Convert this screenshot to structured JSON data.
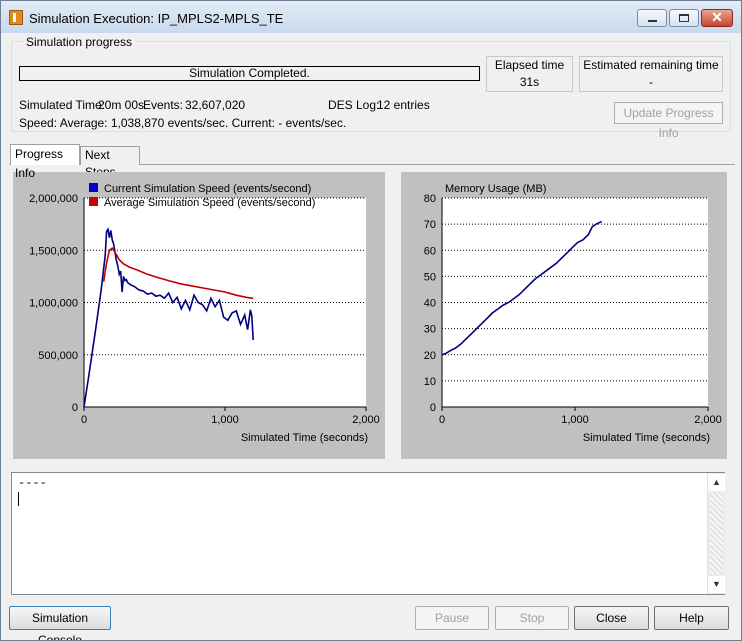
{
  "window": {
    "title": "Simulation Execution: IP_MPLS2-MPLS_TE"
  },
  "progress": {
    "group_label": "Simulation progress",
    "status": "Simulation Completed.",
    "elapsed_label": "Elapsed time",
    "elapsed_value": "31s",
    "remaining_label": "Estimated remaining time",
    "remaining_value": "-",
    "simulated_time_label": "Simulated Time:",
    "simulated_time_value": "20m 00s",
    "events_label": "Events:",
    "events_value": "32,607,020",
    "des_log_label": "DES Log:",
    "des_log_value": "12 entries",
    "speed_line": "Speed: Average: 1,038,870 events/sec. Current: - events/sec.",
    "update_button": "Update Progress Info"
  },
  "tabs": [
    {
      "label": "Progress Info"
    },
    {
      "label": "Next Steps"
    }
  ],
  "chart_data": [
    {
      "type": "line",
      "xlabel": "Simulated Time (seconds)",
      "ylabel": "",
      "xlim": [
        0,
        2000
      ],
      "ylim": [
        0,
        2000000
      ],
      "x_ticks": [
        "0",
        "1,000",
        "2,000"
      ],
      "y_ticks": [
        "0",
        "500,000",
        "1,000,000",
        "1,500,000",
        "2,000,000"
      ],
      "grid": "horizontal",
      "legend": "top",
      "series": [
        {
          "name": "Current Simulation Speed (events/second)",
          "color": "#000080",
          "x": [
            0,
            40,
            80,
            120,
            150,
            160,
            170,
            180,
            190,
            200,
            210,
            220,
            230,
            240,
            250,
            260,
            270,
            280,
            290,
            300,
            310,
            330,
            360,
            390,
            420,
            450,
            480,
            510,
            540,
            570,
            600,
            630,
            660,
            690,
            720,
            750,
            780,
            810,
            840,
            870,
            900,
            930,
            960,
            990,
            1020,
            1050,
            1080,
            1110,
            1140,
            1160,
            1180,
            1190,
            1200
          ],
          "y": [
            0,
            350000,
            720000,
            1100000,
            1450000,
            1680000,
            1700000,
            1620000,
            1690000,
            1600000,
            1560000,
            1480000,
            1400000,
            1350000,
            1270000,
            1300000,
            1100000,
            1250000,
            1210000,
            1220000,
            1190000,
            1170000,
            1150000,
            1120000,
            1110000,
            1080000,
            1090000,
            1060000,
            1070000,
            1040000,
            1090000,
            1000000,
            1050000,
            940000,
            1020000,
            930000,
            1070000,
            1000000,
            980000,
            920000,
            1040000,
            960000,
            1020000,
            860000,
            830000,
            900000,
            920000,
            790000,
            880000,
            740000,
            930000,
            870000,
            640000
          ]
        },
        {
          "name": "Average Simulation Speed (events/second)",
          "color": "#c00000",
          "x": [
            140,
            160,
            180,
            200,
            220,
            250,
            280,
            320,
            380,
            450,
            520,
            600,
            680,
            760,
            840,
            920,
            1000,
            1080,
            1150,
            1200
          ],
          "y": [
            1200000,
            1380000,
            1500000,
            1520000,
            1480000,
            1410000,
            1370000,
            1340000,
            1310000,
            1270000,
            1240000,
            1210000,
            1180000,
            1160000,
            1140000,
            1120000,
            1100000,
            1070000,
            1050000,
            1040000
          ]
        }
      ]
    },
    {
      "type": "line",
      "title": "Memory Usage (MB)",
      "xlabel": "Simulated Time (seconds)",
      "ylabel": "",
      "xlim": [
        0,
        2000
      ],
      "ylim": [
        0,
        80
      ],
      "x_ticks": [
        "0",
        "1,000",
        "2,000"
      ],
      "y_ticks": [
        "0",
        "10",
        "20",
        "30",
        "40",
        "50",
        "60",
        "70",
        "80"
      ],
      "grid": "horizontal",
      "series": [
        {
          "name": "",
          "color": "#000080",
          "x": [
            0,
            30,
            60,
            100,
            140,
            180,
            220,
            260,
            300,
            340,
            380,
            420,
            460,
            500,
            540,
            580,
            620,
            660,
            700,
            740,
            780,
            820,
            860,
            900,
            940,
            980,
            1020,
            1060,
            1100,
            1130,
            1160,
            1180,
            1200
          ],
          "y": [
            20,
            20.5,
            21.5,
            22.5,
            24,
            26,
            28,
            30,
            32,
            34,
            36,
            37.5,
            39,
            40,
            41.5,
            43,
            45,
            47,
            49,
            50.5,
            52,
            53.5,
            55,
            57,
            59,
            61,
            63,
            64,
            66,
            69,
            70,
            70.5,
            71
          ]
        }
      ]
    }
  ],
  "console": {
    "text": "----"
  },
  "buttons": {
    "console": "Simulation Console",
    "pause": "Pause",
    "stop": "Stop",
    "close": "Close",
    "help": "Help"
  }
}
